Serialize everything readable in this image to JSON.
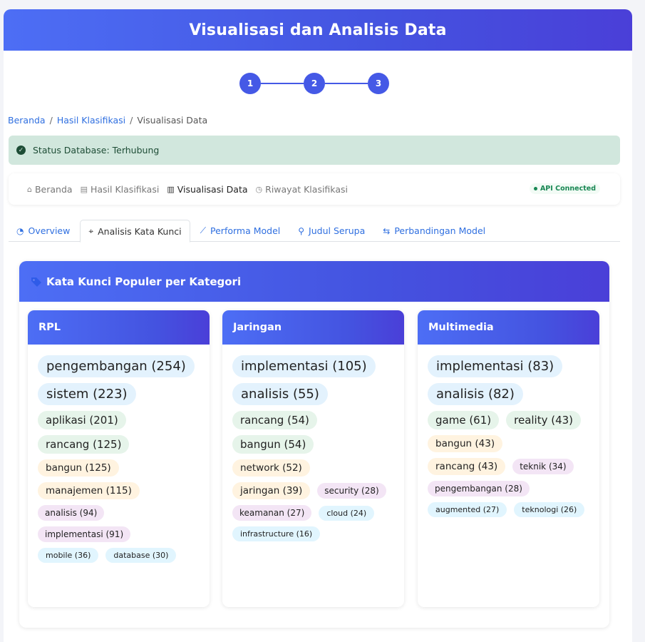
{
  "app": {
    "title": "Visualisasi dan Analisis Data"
  },
  "stepper": {
    "steps": [
      "1",
      "2",
      "3"
    ]
  },
  "breadcrumb": {
    "items": [
      "Beranda",
      "Hasil Klasifikasi",
      "Visualisasi Data"
    ]
  },
  "status": {
    "text": "Status Database: Terhubung"
  },
  "navbar": {
    "items": [
      {
        "icon": "home-icon",
        "label": "Beranda"
      },
      {
        "icon": "file-icon",
        "label": "Hasil Klasifikasi"
      },
      {
        "icon": "bar-chart-icon",
        "label": "Visualisasi Data"
      },
      {
        "icon": "clock-icon",
        "label": "Riwayat Klasifikasi"
      }
    ],
    "api_status": "API Connected"
  },
  "tabs": [
    {
      "icon": "pie-chart-icon",
      "label": "Overview"
    },
    {
      "icon": "tag-icon",
      "label": "Analisis Kata Kunci"
    },
    {
      "icon": "line-chart-icon",
      "label": "Performa Model"
    },
    {
      "icon": "search-icon",
      "label": "Judul Serupa"
    },
    {
      "icon": "swap-icon",
      "label": "Perbandingan Model"
    }
  ],
  "panel": {
    "title": "Kata Kunci Populer per Kategori",
    "categories": [
      {
        "name": "RPL",
        "keywords": [
          "pengembangan (254)",
          "sistem (223)",
          "aplikasi (201)",
          "rancang (125)",
          "bangun (125)",
          "manajemen (115)",
          "analisis (94)",
          "implementasi (91)",
          "mobile (36)",
          "database (30)"
        ]
      },
      {
        "name": "Jaringan",
        "keywords": [
          "implementasi (105)",
          "analisis (55)",
          "rancang (54)",
          "bangun (54)",
          "network (52)",
          "jaringan (39)",
          "security (28)",
          "keamanan (27)",
          "cloud (24)",
          "infrastructure (16)"
        ]
      },
      {
        "name": "Multimedia",
        "keywords": [
          "implementasi (83)",
          "analisis (82)",
          "game (61)",
          "reality (43)",
          "bangun (43)",
          "rancang (43)",
          "teknik (34)",
          "pengembangan (28)",
          "augmented (27)",
          "teknologi (26)"
        ]
      }
    ]
  },
  "colors": {
    "accent": "#4559e6",
    "link": "#2f6fe0",
    "status_bg": "#d1e7dd",
    "keyword_blue": "#e3f2fd",
    "keyword_green": "#e6f4ea",
    "keyword_orange": "#fff3e0",
    "keyword_purple": "#f3e5f5",
    "keyword_cyan": "#e1f5fe"
  }
}
